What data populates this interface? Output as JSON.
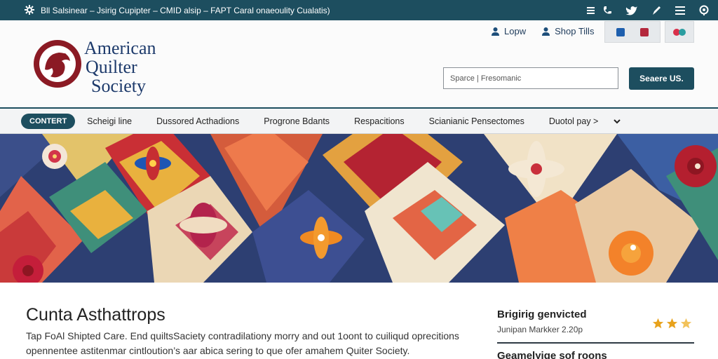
{
  "topbar": {
    "announcement": "Bll Salsinear – Jsirig Cupipter – CMID alsip – FAPT Caral onaeoulity Cualatis)",
    "social_icons": [
      "menu-icon",
      "phone-icon",
      "twitter-icon",
      "pen-icon",
      "list-icon",
      "pin-icon"
    ]
  },
  "header": {
    "logo_line1": "American",
    "logo_line2": "Quilter",
    "logo_line3": "Society",
    "login_label": "Lopw",
    "shop_label": "Shop Tills",
    "search": {
      "placeholder": "Sparce | Fresomanic",
      "button_label": "Seaere US."
    }
  },
  "nav": {
    "pill_label": "CONTERT",
    "items": [
      "Scheigi line",
      "Dussored Acthadions",
      "Progrone Bdants",
      "Respacitions",
      "Scianianic Pensectomes",
      "Duotol pay >"
    ]
  },
  "content": {
    "title": "Cunta Asthattrops",
    "body": "Tap FoAl Shipted Care. End quiltsSaciety contradilationy morry and out 1oont to cuiliqud oprecitions opennentee astitenmar cintloution’s aar abica sering to que ofer amahem Quiter Society."
  },
  "sidebar": {
    "item_title": "Brigirig genvicted",
    "item_sub": "Junipan Markker 2.20p",
    "rating_stars": 3,
    "next_title": "Geamelyige sof roons"
  },
  "colors": {
    "primary": "#1d4e5f",
    "logo_red": "#8b1a24",
    "logo_blue": "#1d3a6b",
    "star": "#e8a21c"
  }
}
